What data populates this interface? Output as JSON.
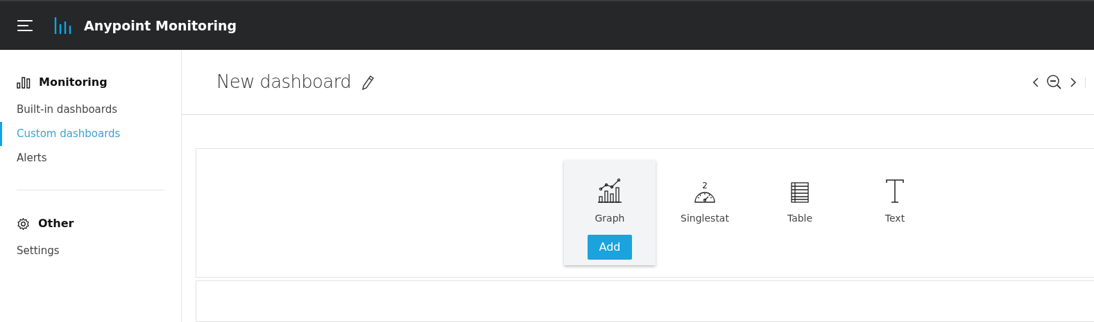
{
  "header": {
    "title": "Anypoint Monitoring"
  },
  "sidebar": {
    "sections": [
      {
        "kind": "monitoring",
        "title": "Monitoring",
        "items": [
          {
            "label": "Built-in dashboards",
            "selected": false
          },
          {
            "label": "Custom dashboards",
            "selected": true
          },
          {
            "label": "Alerts",
            "selected": false
          }
        ]
      },
      {
        "kind": "settings",
        "title": "Other",
        "items": [
          {
            "label": "Settings",
            "selected": false
          }
        ]
      }
    ]
  },
  "dashboard": {
    "title": "New dashboard"
  },
  "panel_types": [
    {
      "kind": "graph",
      "label": "Graph",
      "selected": true,
      "button": "Add"
    },
    {
      "kind": "singlestat",
      "label": "Singlestat",
      "selected": false,
      "icon_digit": "2"
    },
    {
      "kind": "table",
      "label": "Table",
      "selected": false
    },
    {
      "kind": "text",
      "label": "Text",
      "selected": false
    }
  ]
}
